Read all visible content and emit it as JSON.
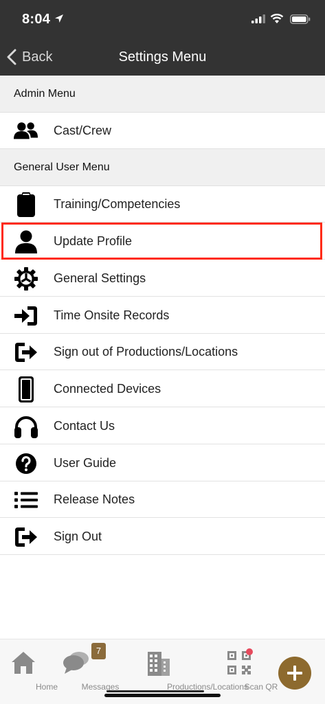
{
  "status": {
    "time": "8:04"
  },
  "nav": {
    "back_label": "Back",
    "title": "Settings Menu"
  },
  "sections": {
    "admin": "Admin Menu",
    "general": "General User Menu"
  },
  "admin_items": [
    {
      "label": "Cast/Crew",
      "icon": "users-icon"
    }
  ],
  "general_items": [
    {
      "label": "Training/Competencies",
      "icon": "clipboard-icon"
    },
    {
      "label": "Update Profile",
      "icon": "user-icon"
    },
    {
      "label": "General Settings",
      "icon": "gear-icon"
    },
    {
      "label": "Time Onsite Records",
      "icon": "sign-in-icon"
    },
    {
      "label": "Sign out of Productions/Locations",
      "icon": "sign-out-icon"
    },
    {
      "label": "Connected Devices",
      "icon": "phone-icon"
    },
    {
      "label": "Contact Us",
      "icon": "headphones-icon"
    },
    {
      "label": "User Guide",
      "icon": "question-circle-icon"
    },
    {
      "label": "Release Notes",
      "icon": "list-icon"
    },
    {
      "label": "Sign Out",
      "icon": "sign-out-icon"
    }
  ],
  "tabs": {
    "home": "Home",
    "messages": "Messages",
    "messages_badge": "7",
    "productions": "Productions/Locations",
    "scan": "Scan QR"
  },
  "colors": {
    "nav_bg": "#333333",
    "accent_gold": "#8d6a2e",
    "highlight": "#ff2a12"
  }
}
